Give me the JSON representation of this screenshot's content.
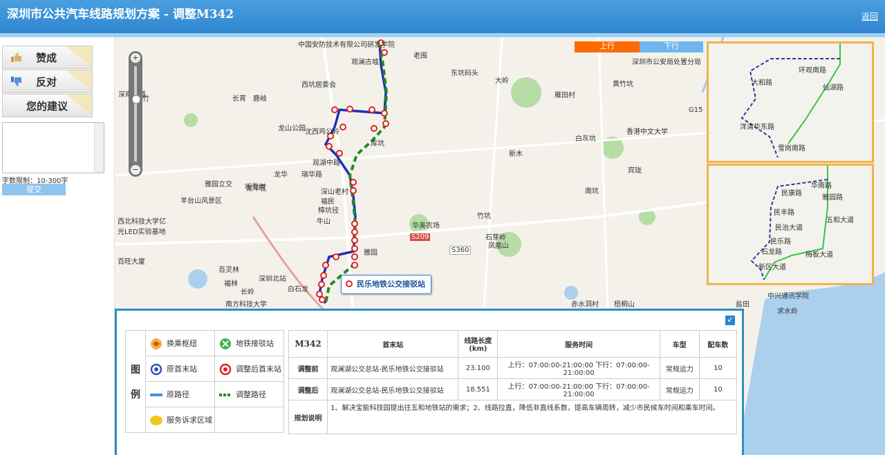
{
  "header": {
    "title": "深圳市公共汽车线路规划方案 - 调整M342",
    "back": "返回"
  },
  "sidebar": {
    "agree": "赞成",
    "oppose": "反对",
    "suggest": "您的建议",
    "limit": "字数限制：10-300字",
    "submit": "提交"
  },
  "map": {
    "tab_up": "上行",
    "tab_down": "下行",
    "tab_up_color": "#ff6a00",
    "tab_down_color": "#6fb6f0",
    "tooltip": "民乐地铁公交接驳站",
    "labels": [
      "中国安防技术有限公司研发学院",
      "观澜古墟",
      "老围",
      "东坑码头",
      "大岭",
      "雁田村",
      "黄竹坑",
      "深圳市公安局处置分局",
      "G15",
      "西坑居委会",
      "沈西鸡公岭",
      "龙山公园",
      "长宵",
      "库坑",
      "观湖中路",
      "瑞华路",
      "深山老村",
      "福民",
      "樟坑径",
      "牛山",
      "华美农场",
      "竹坑",
      "石芽岭",
      "凤凰山",
      "雅园",
      "白石龙",
      "长岭",
      "福林",
      "百灵林",
      "深圳北站",
      "南方科技大学",
      "赤水洞村",
      "梧桐山",
      "求水岭",
      "中兴通讯学院",
      "盐田",
      "新木",
      "白灰坑",
      "香港中文大学",
      "宾珑",
      "南坑",
      "鹿岐",
      "翠竹",
      "深南大道",
      "坂雪岗",
      "西北科技大学亿光LED实验基地",
      "百旺大厦",
      "龙华",
      "龙华区",
      "羊台山风景区",
      "S209",
      "S360",
      "雅园立交"
    ],
    "inset_top": [
      "大和路",
      "环观南路",
      "仙湖路",
      "洋清华东路",
      "雪岗南路"
    ],
    "inset_bottom": [
      "华南路",
      "民康路",
      "雅园路",
      "民丰路",
      "五和大道",
      "民治大道",
      "民乐路",
      "石龙路",
      "梅板大道",
      "新区大道"
    ]
  },
  "legend": {
    "heading": [
      "图",
      "例"
    ],
    "items": [
      {
        "name": "换乘枢纽",
        "icon": "transfer-hub-icon"
      },
      {
        "name": "地铁接驳站",
        "icon": "metro-connection-icon"
      },
      {
        "name": "原首末站",
        "icon": "original-terminal-icon"
      },
      {
        "name": "调整后首末站",
        "icon": "adjusted-terminal-icon"
      },
      {
        "name": "原路径",
        "icon": "original-route-icon"
      },
      {
        "name": "调整路径",
        "icon": "adjusted-route-icon"
      },
      {
        "name": "服务诉求区域",
        "icon": "service-area-icon"
      }
    ]
  },
  "table": {
    "headers": [
      "M342",
      "首末站",
      "线路长度(km)",
      "服务时间",
      "车型",
      "配车数"
    ],
    "rows": [
      {
        "label": "调整前",
        "terminals": "观澜湖公交总站-民乐地铁公交接驳站",
        "length": "23.100",
        "time": "上行：07:00:00-21:00:00 下行：07:00:00-21:00:00",
        "type": "常规运力",
        "count": "10"
      },
      {
        "label": "调整后",
        "terminals": "观澜湖公交总站-民乐地铁公交接驳站",
        "length": "18.551",
        "time": "上行：07:00:00-21:00:00 下行：07:00:00-21:00:00",
        "type": "常规运力",
        "count": "10"
      }
    ],
    "note_label": "规划说明",
    "note": "1、解决宝能科技园提出往五和地铁站的需求；2、线路拉直，降低非直线系数，提高车辆周转，减少市民候车时间和乘车时间。"
  }
}
